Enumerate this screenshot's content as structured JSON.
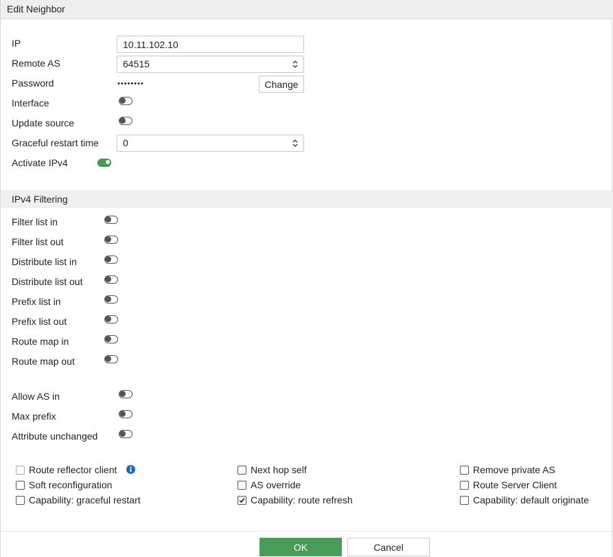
{
  "dialog": {
    "title": "Edit Neighbor"
  },
  "fields": {
    "ip": {
      "label": "IP",
      "value": "10.11.102.10"
    },
    "remote_as": {
      "label": "Remote AS",
      "value": "64515"
    },
    "password": {
      "label": "Password",
      "masked": "••••••••",
      "change_label": "Change"
    },
    "interface": {
      "label": "Interface",
      "enabled": false
    },
    "update_source": {
      "label": "Update source",
      "enabled": false
    },
    "graceful_restart_time": {
      "label": "Graceful restart time",
      "value": "0"
    },
    "activate_ipv4": {
      "label": "Activate IPv4",
      "enabled": true
    }
  },
  "ipv4_filtering": {
    "title": "IPv4 Filtering",
    "items": [
      {
        "label": "Filter list in",
        "enabled": false
      },
      {
        "label": "Filter list out",
        "enabled": false
      },
      {
        "label": "Distribute list in",
        "enabled": false
      },
      {
        "label": "Distribute list out",
        "enabled": false
      },
      {
        "label": "Prefix list in",
        "enabled": false
      },
      {
        "label": "Prefix list out",
        "enabled": false
      },
      {
        "label": "Route map in",
        "enabled": false
      },
      {
        "label": "Route map out",
        "enabled": false
      }
    ]
  },
  "advanced": {
    "items": [
      {
        "label": "Allow AS in",
        "enabled": false
      },
      {
        "label": "Max prefix",
        "enabled": false
      },
      {
        "label": "Attribute unchanged",
        "enabled": false
      }
    ]
  },
  "options": {
    "col1": [
      {
        "label": "Route reflector client",
        "checked": false,
        "disabled": true
      },
      {
        "label": "Soft reconfiguration",
        "checked": false
      },
      {
        "label": "Capability: graceful restart",
        "checked": false
      }
    ],
    "col2": [
      {
        "label": "Next hop self",
        "checked": false
      },
      {
        "label": "AS override",
        "checked": false
      },
      {
        "label": "Capability: route refresh",
        "checked": true
      }
    ],
    "col3": [
      {
        "label": "Remove private AS",
        "checked": false
      },
      {
        "label": "Route Server Client",
        "checked": false
      },
      {
        "label": "Capability: default originate",
        "checked": false
      }
    ]
  },
  "footer": {
    "ok_label": "OK",
    "cancel_label": "Cancel"
  },
  "colors": {
    "accent_green": "#4a9c5a",
    "info_blue": "#2266bb"
  }
}
